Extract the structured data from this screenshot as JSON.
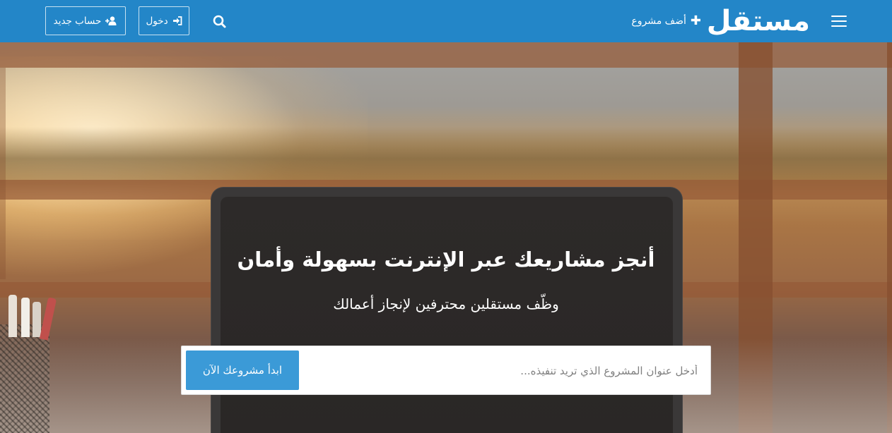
{
  "header": {
    "logo_text": "مستقل",
    "add_project_label": "أضف مشروع",
    "login_label": "دخول",
    "register_label": "حساب جديد",
    "background_color": "#2386c8"
  },
  "hero": {
    "title": "أنجز مشاريعك عبر الإنترنت بسهولة وأمان",
    "subtitle": "وظّف مستقلين محترفين لإنجاز أعمالك"
  },
  "project_form": {
    "placeholder": "أدخل عنوان المشروع الذي تريد تنفيذه...",
    "submit_label": "ابدأ مشروعك الآن",
    "submit_color": "#3b9ad7"
  },
  "icons": {
    "menu": "hamburger-menu-icon",
    "add": "plus-icon",
    "search": "search-icon",
    "login": "sign-in-icon",
    "register": "user-plus-icon"
  }
}
